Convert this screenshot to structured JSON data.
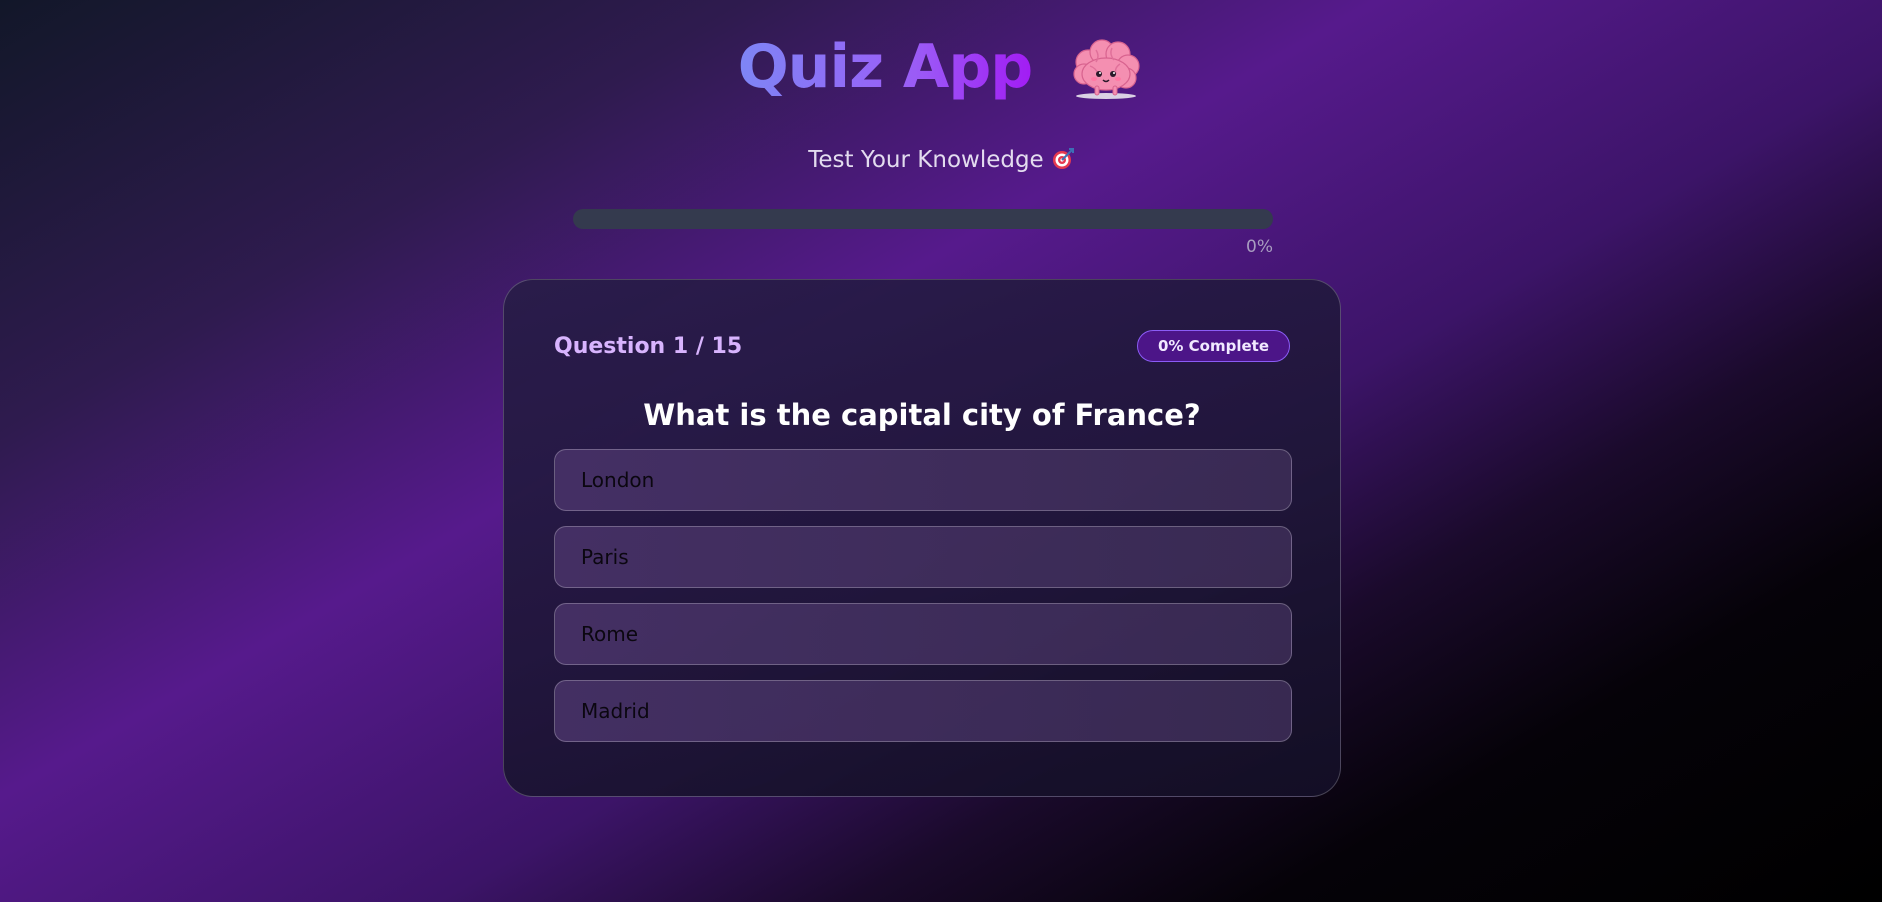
{
  "header": {
    "title": "Quiz App",
    "subtitle": "Test Your Knowledge"
  },
  "progress": {
    "percent": 0,
    "label": "0%"
  },
  "card": {
    "question_counter": "Question 1 / 15",
    "badge": "0% Complete",
    "question": "What is the capital city of France?",
    "options": [
      {
        "label": "London"
      },
      {
        "label": "Paris"
      },
      {
        "label": "Rome"
      },
      {
        "label": "Madrid"
      }
    ]
  },
  "icons": {
    "title_icon": "brain-icon",
    "subtitle_icon": "target-icon"
  },
  "colors": {
    "accent_start": "#7e86f5",
    "accent_end": "#a21cf4",
    "question_counter": "#d8b4fe",
    "progress_track": "#343a4e"
  }
}
